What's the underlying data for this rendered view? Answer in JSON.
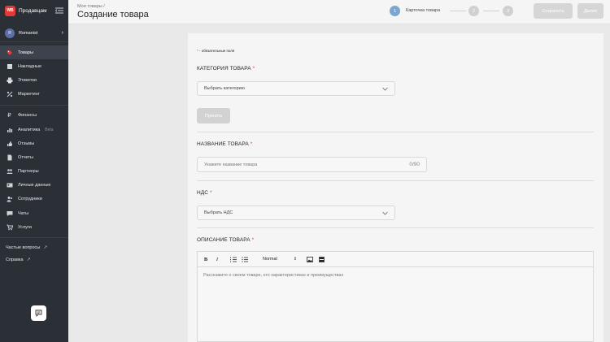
{
  "sidebar": {
    "brand_logo_text": "WB",
    "brand_name": "Продавцам",
    "user": {
      "initial": "R",
      "name": "Romanist"
    },
    "items": [
      {
        "label": "Товары",
        "icon": "tag-icon",
        "active": true
      },
      {
        "label": "Накладные",
        "icon": "box-icon"
      },
      {
        "label": "Этикетки",
        "icon": "printer-icon"
      },
      {
        "label": "Маркетинг",
        "icon": "percent-icon"
      },
      {
        "label": "Финансы",
        "icon": "ruble-icon"
      },
      {
        "label": "Аналитика",
        "icon": "bar-chart-icon",
        "badge": "Beta"
      },
      {
        "label": "Отзывы",
        "icon": "thumbs-icon"
      },
      {
        "label": "Отчеты",
        "icon": "document-icon"
      },
      {
        "label": "Партнеры",
        "icon": "partners-icon"
      },
      {
        "label": "Личные данные",
        "icon": "id-card-icon"
      },
      {
        "label": "Сотрудники",
        "icon": "users-icon"
      },
      {
        "label": "Чаты",
        "icon": "chat-icon"
      },
      {
        "label": "Услуги",
        "icon": "cart-icon"
      }
    ],
    "links": [
      {
        "label": "Частые вопросы"
      },
      {
        "label": "Справка"
      }
    ]
  },
  "header": {
    "breadcrumb": "Мои товары /",
    "title": "Создание товара",
    "steps": [
      {
        "number": "1",
        "label": "Карточка товара",
        "state": "active"
      },
      {
        "number": "2",
        "state": "todo"
      },
      {
        "number": "3",
        "state": "todo"
      }
    ],
    "save_label": "Сохранить",
    "next_label": "Далее"
  },
  "form": {
    "required_note_star": "*",
    "required_note": " - обязательные поля",
    "category": {
      "label": "КАТЕГОРИЯ ТОВАРА",
      "placeholder": "Выбрать категорию",
      "apply_label": "Принять"
    },
    "name": {
      "label": "НАЗВАНИЕ ТОВАРА",
      "placeholder": "Укажите название товара",
      "counter": "0/90"
    },
    "vat": {
      "label": "НДС",
      "placeholder": "Выбрать НДС"
    },
    "description": {
      "label": "ОПИСАНИЕ ТОВАРА",
      "format_value": "Normal",
      "placeholder": "Расскажите о своем товаре, его характеристиках и преимуществах"
    },
    "star": "*"
  },
  "colors": {
    "accent": "#7aa6cf",
    "required": "#e53935",
    "sidebar_bg": "#2b2f36"
  }
}
